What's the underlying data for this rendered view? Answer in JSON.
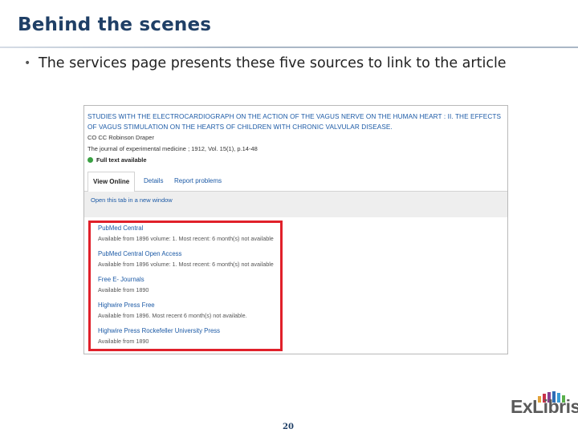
{
  "slide": {
    "title": "Behind the scenes",
    "bullet": "The services page presents these five sources to link to the article",
    "bullet_marker": "•",
    "page_number": "20",
    "logo_text": "ExLibris"
  },
  "record": {
    "title": "STUDIES WITH THE ELECTROCARDIOGRAPH ON THE ACTION OF THE VAGUS NERVE ON THE HUMAN HEART : II. THE EFFECTS OF VAGUS STIMULATION ON THE HEARTS OF CHILDREN WITH CHRONIC VALVULAR DISEASE.",
    "author": "CO CC Robinson Draper",
    "source": "The journal of experimental medicine ; 1912, Vol. 15(1), p.14-48",
    "availability": "Full text available"
  },
  "tabs": [
    {
      "label": "View Online"
    },
    {
      "label": "Details"
    },
    {
      "label": "Report problems"
    }
  ],
  "open_link": "Open this tab in a new window",
  "services": [
    {
      "name": "PubMed Central",
      "availability": "Available from 1896 volume: 1. Most recent: 6 month(s) not available"
    },
    {
      "name": "PubMed Central Open Access",
      "availability": "Available from 1896 volume: 1. Most recent: 6 month(s) not available"
    },
    {
      "name": "Free E- Journals",
      "availability": "Available from 1890"
    },
    {
      "name": "Highwire Press Free",
      "availability": "Available from 1896. Most recent 6 month(s) not available."
    },
    {
      "name": "Highwire Press Rockefeller University Press",
      "availability": "Available from 1890"
    }
  ],
  "colors": {
    "title": "#1f3f66",
    "link": "#1c5aa6",
    "highlight": "#e0202a",
    "available": "#3aa143"
  }
}
